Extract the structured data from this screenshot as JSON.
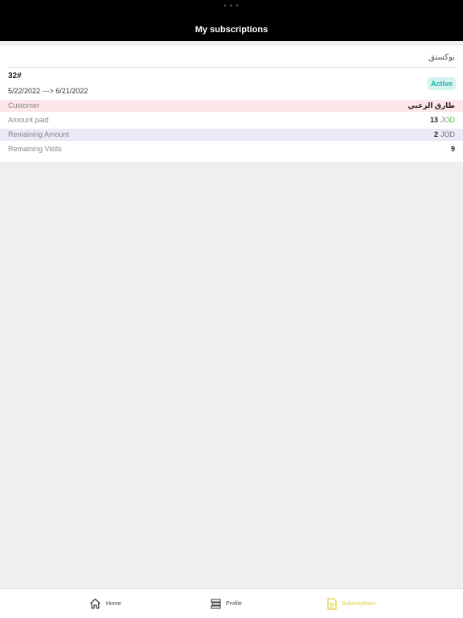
{
  "header": {
    "top_dots": "• • •",
    "title": "My subscriptions"
  },
  "subscription": {
    "location": "بوكستق",
    "code": "32#",
    "dates": "5/22/2022 ---> 6/21/2022",
    "status": "Active",
    "rows": [
      {
        "label": "Customer",
        "value": "طارق الزعبي"
      },
      {
        "label": "Amount paid",
        "value": "13",
        "currency": "JOD"
      },
      {
        "label": "Remaining Amount",
        "value": "2",
        "currency": "JOD"
      },
      {
        "label": "Remaining Visits",
        "value": "9"
      }
    ]
  },
  "tabs": [
    {
      "label": "Home",
      "icon": "home-icon",
      "active": false
    },
    {
      "label": "Profile",
      "icon": "profile-list-icon",
      "active": false
    },
    {
      "label": "Subscriptions",
      "icon": "document-icon",
      "active": true
    }
  ],
  "colors": {
    "header_bg": "#000000",
    "status_text": "#1ab2a4",
    "status_bg": "#d3f3f1",
    "currency": "#6aa84f",
    "active_tab": "#e0cf2e",
    "customer_row_bg": "#fde6ea",
    "remaining_row_bg": "#ebe8f7"
  }
}
